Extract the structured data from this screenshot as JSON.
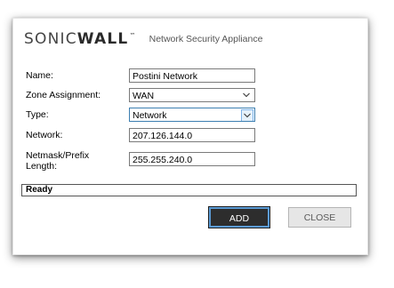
{
  "header": {
    "brand_light": "SONIC",
    "brand_bold": "WALL",
    "brand_tm": "™",
    "product": "Network Security Appliance"
  },
  "form": {
    "name": {
      "label": "Name:",
      "value": "Postini Network"
    },
    "zone": {
      "label": "Zone Assignment:",
      "value": "WAN"
    },
    "type": {
      "label": "Type:",
      "value": "Network"
    },
    "network": {
      "label": "Network:",
      "value": "207.126.144.0"
    },
    "netmask": {
      "label_line1": "Netmask/Prefix",
      "label_line2": "Length:",
      "value": "255.255.240.0"
    }
  },
  "status": {
    "text": "Ready"
  },
  "buttons": {
    "add": "ADD",
    "close": "CLOSE"
  },
  "icons": {
    "dropdown": "chevron-down-icon"
  },
  "colors": {
    "accent": "#5b9bd5",
    "primary_button": "#2d2d2d",
    "secondary_button": "#e6e6e6"
  }
}
